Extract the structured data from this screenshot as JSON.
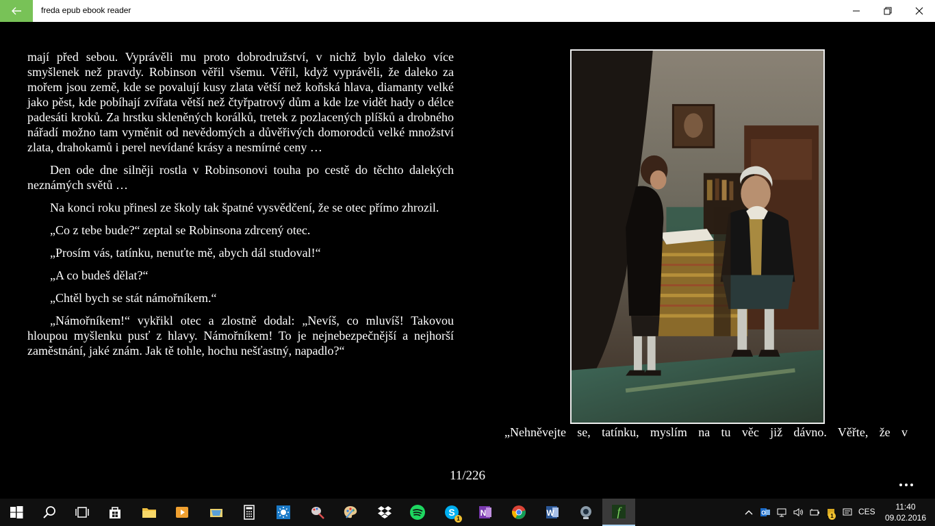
{
  "window": {
    "title": "freda epub ebook reader"
  },
  "reader": {
    "paragraphs": [
      "mají před sebou. Vyprávěli mu proto dobrodružství, v nichž bylo daleko více smyšlenek než pravdy. Robinson věřil všemu. Věřil, když vyprávěli, že daleko za mořem jsou země, kde se povalují kusy zlata větší než koňská hlava, diamanty velké jako pěst, kde pobíhají zvířata větší než čtyřpatrový dům a kde lze vidět hady o délce padesáti kroků. Za hrstku skleněných korálků, tretek z pozlacených plíšků a drobného nářadí možno tam vyměnit od nevědomých a důvěřivých domorodců velké množství zlata, drahokamů i perel nevídané krásy a nesmírné ceny …",
      "Den ode dne silněji rostla v Robinsonovi touha po cestě do těchto dalekých neznámých světů …",
      "Na konci roku přinesl ze školy tak špatné vysvědčení, že se otec přímo zhrozil.",
      "„Co z tebe bude?“ zeptal se Robinsona zdrcený otec.",
      "„Prosím vás, tatínku, nenuťte mě, abych dál studoval!“",
      "„A co budeš dělat?“",
      "„Chtěl bych se stát námořníkem.“",
      "„Námořníkem!“ vykřikl otec a zlostně dodal: „Nevíš, co mluvíš! Takovou hloupou myšlenku pusť z hlavy. Námořníkem! To je nejnebezpečnější a nejhorší zaměstnání, jaké znám. Jak tě tohle, hochu nešťastný, napadlo?“"
    ],
    "right_page_line": "„Nehněvejte se, tatínku, myslím na tu věc již dávno. Věřte, že v",
    "page_indicator": "11/226",
    "more_label": "•••"
  },
  "taskbar": {
    "apps": [
      "start",
      "search",
      "task-view",
      "store",
      "file-explorer",
      "media-player",
      "folder-app",
      "calculator",
      "weather",
      "paint-brush",
      "paint",
      "dropbox",
      "spotify",
      "skype",
      "onenote",
      "chrome",
      "word",
      "webcam",
      "freda"
    ],
    "skype_badge": "1",
    "tray_badge": "1",
    "language": "CES",
    "time": "11:40",
    "date": "09.02.2016"
  },
  "colors": {
    "accent": "#78c257",
    "background": "#000000",
    "taskbar": "#101010"
  }
}
